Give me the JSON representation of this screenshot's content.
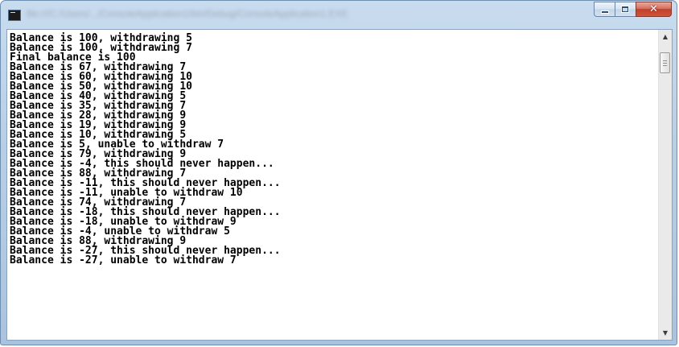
{
  "window": {
    "title": "file:///C:/Users/.../ConsoleApplication1/bin/Debug/ConsoleApplication1.EXE",
    "icons": {
      "app": "console-app-icon",
      "minimize": "minimize-icon",
      "maximize": "maximize-icon",
      "close": "close-icon"
    },
    "close_glyph": "✕",
    "accent_close": "#c2402a"
  },
  "console": {
    "lines": [
      "Balance is 100, withdrawing 5",
      "Balance is 100, withdrawing 7",
      "Final balance is 100",
      "Balance is 67, withdrawing 7",
      "Balance is 60, withdrawing 10",
      "Balance is 50, withdrawing 10",
      "Balance is 40, withdrawing 5",
      "Balance is 35, withdrawing 7",
      "Balance is 28, withdrawing 9",
      "Balance is 19, withdrawing 9",
      "Balance is 10, withdrawing 5",
      "Balance is 5, unable to withdraw 7",
      "Balance is 79, withdrawing 9",
      "Balance is -4, this should never happen...",
      "Balance is 88, withdrawing 7",
      "Balance is -11, this should never happen...",
      "Balance is -11, unable to withdraw 10",
      "Balance is 74, withdrawing 7",
      "Balance is -18, this should never happen...",
      "Balance is -18, unable to withdraw 9",
      "Balance is -4, unable to withdraw 5",
      "Balance is 88, withdrawing 9",
      "Balance is -27, this should never happen...",
      "Balance is -27, unable to withdraw 7"
    ]
  },
  "scrollbar": {
    "up_arrow": "▲",
    "down_arrow": "▼",
    "icons": {
      "up": "scroll-up-arrow-icon",
      "down": "scroll-down-arrow-icon"
    }
  }
}
